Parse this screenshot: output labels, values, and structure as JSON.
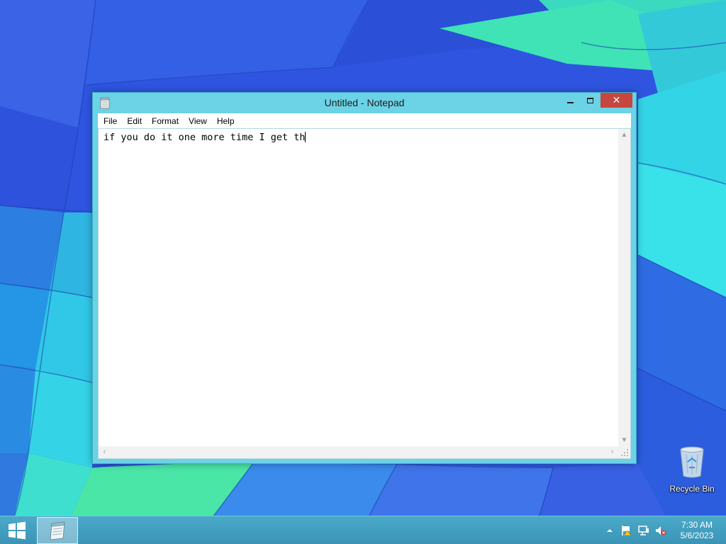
{
  "window": {
    "title": "Untitled - Notepad",
    "close_glyph": "✕"
  },
  "menu": [
    "File",
    "Edit",
    "Format",
    "View",
    "Help"
  ],
  "editor": {
    "text": "if you do it one more time I get th"
  },
  "desktop": {
    "icons": [
      {
        "label": "Recycle Bin",
        "icon": "recycle-bin-icon"
      }
    ]
  },
  "taskbar": {
    "tray_icons": [
      "show-hidden-icons-chevron",
      "action-center-flag-icon",
      "network-icon",
      "volume-muted-icon"
    ],
    "time": "7:30 AM",
    "date": "5/6/2023"
  },
  "colors": {
    "window_frame": "#6cd2e6",
    "close_button": "#c7463e",
    "taskbar": "#3b94b6"
  }
}
